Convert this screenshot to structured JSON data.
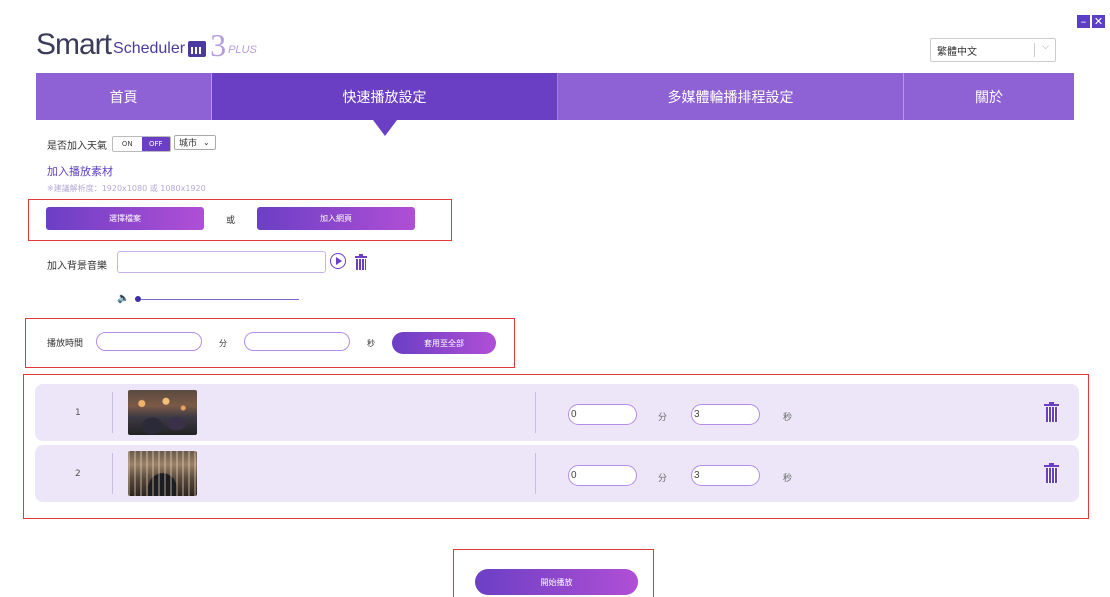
{
  "app": {
    "logo_word": "Smart",
    "logo_sub": "Scheduler",
    "logo_version": "3",
    "logo_plus": "PLUS",
    "language": "繁體中文",
    "window_buttons": [
      "–",
      "✕"
    ]
  },
  "nav": {
    "tabs": [
      {
        "label": "首頁",
        "active": false
      },
      {
        "label": "快速播放設定",
        "active": true
      },
      {
        "label": "多媒體輪播排程設定",
        "active": false
      },
      {
        "label": "關於",
        "active": false
      }
    ]
  },
  "weather": {
    "label": "是否加入天氣",
    "on": "ON",
    "off": "OFF",
    "city": "城市"
  },
  "material": {
    "title": "加入播放素材",
    "hint": "※建議解析度：1920x1080 或 1080x1920",
    "choose_file": "選擇檔案",
    "or": "或",
    "add_webpage": "加入網頁"
  },
  "music": {
    "label": "加入背景音樂",
    "value": ""
  },
  "duration": {
    "label": "播放時間",
    "min_unit": "分",
    "sec_unit": "秒",
    "minutes": "",
    "seconds": "",
    "apply_all": "套用至全部"
  },
  "items": [
    {
      "index": "1",
      "minutes": "0",
      "seconds": "3",
      "min_unit": "分",
      "sec_unit": "秒"
    },
    {
      "index": "2",
      "minutes": "0",
      "seconds": "3",
      "min_unit": "分",
      "sec_unit": "秒"
    }
  ],
  "start_button": "開始播放",
  "icons": {
    "play": "play-circle-icon",
    "trash": "trash-icon",
    "volume": "volume-icon",
    "dropdown": "chevron-down-icon"
  },
  "colors": {
    "primary": "#6b3fc4",
    "nav": "#8e62d4",
    "accent_gradient_end": "#b04fd6",
    "highlight_box": "#e03a3a",
    "row_bg": "#ece6f8"
  }
}
